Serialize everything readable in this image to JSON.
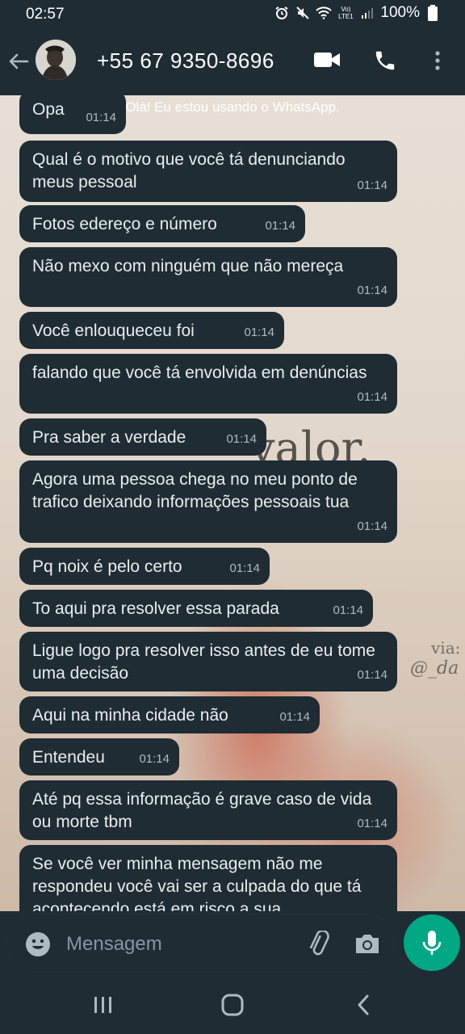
{
  "status_bar": {
    "time": "02:57",
    "battery": "100%",
    "network_label": "Vo) LTE1"
  },
  "header": {
    "contact": "+55 67 9350-8696"
  },
  "chat": {
    "banner": "Olá! Eu estou usando o WhatsApp.",
    "messages": [
      {
        "text": "Opa",
        "time": "01:14"
      },
      {
        "text": "Qual é o motivo que você tá denunciando meus pessoal",
        "time": "01:14"
      },
      {
        "text": "Fotos edereço e número",
        "time": "01:14"
      },
      {
        "text": "Não mexo com ninguém que não mereça",
        "time": "01:14"
      },
      {
        "text": "Você enlouqueceu foi",
        "time": "01:14"
      },
      {
        "text": "falando que você tá envolvida em denúncias",
        "time": "01:14"
      },
      {
        "text": "Pra saber a verdade",
        "time": "01:14"
      },
      {
        "text": "Agora uma pessoa chega no meu ponto de trafico deixando informações pessoais tua",
        "time": "01:14"
      },
      {
        "text": "Pq noix é pelo certo",
        "time": "01:14"
      },
      {
        "text": "To aqui pra resolver essa parada",
        "time": "01:14"
      },
      {
        "text": "Ligue logo pra resolver isso antes de eu tome uma decisão",
        "time": "01:14"
      },
      {
        "text": "Aqui na minha cidade não",
        "time": "01:14"
      },
      {
        "text": "Entendeu",
        "time": "01:14"
      },
      {
        "text": "Até pq essa informação é grave caso de vida ou morte tbm",
        "time": "01:14"
      },
      {
        "text": "Se você ver minha mensagem não me respondeu você vai ser a culpada do que tá acontecendo está em risco a sua",
        "time": ""
      }
    ],
    "wallpaper": {
      "word": "valor.",
      "via": "via:",
      "handle": "@_da"
    }
  },
  "input": {
    "placeholder": "Mensagem"
  },
  "colors": {
    "bar": "#1f2c34",
    "bubble": "#1f2c34",
    "accent": "#00a884",
    "timestamp": "#aebac1"
  },
  "icons": {
    "back": "arrow-left-icon",
    "video": "video-camera-icon",
    "call": "phone-icon",
    "more": "more-vertical-icon",
    "emoji": "emoji-icon",
    "attach": "paperclip-icon",
    "camera": "camera-icon",
    "mic": "microphone-icon"
  }
}
